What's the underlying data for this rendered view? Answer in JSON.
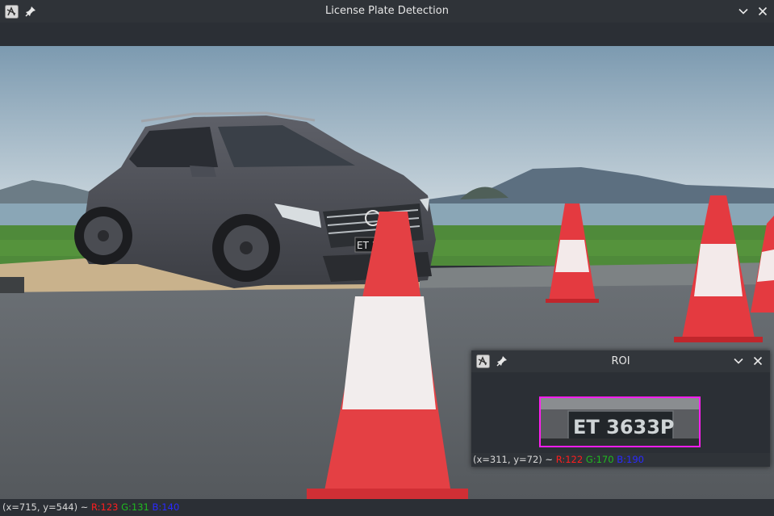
{
  "main_window": {
    "title": "License Plate Detection",
    "status": {
      "coords": "(x=715, y=544) ~ ",
      "r": "R:123",
      "g": "G:131",
      "b": "B:140"
    }
  },
  "scene": {
    "plate_text": "ET 3633P",
    "plate_partial": "ET 3"
  },
  "roi_window": {
    "title": "ROI",
    "status": {
      "coords": "(x=311, y=72) ~ ",
      "r": "R:122",
      "g": "G:170",
      "b": "B:190"
    },
    "highlight_color": "#ff1ef0"
  },
  "icons": [
    "app-logo-icon",
    "pin-icon",
    "minimize-chevron-icon",
    "close-icon"
  ]
}
